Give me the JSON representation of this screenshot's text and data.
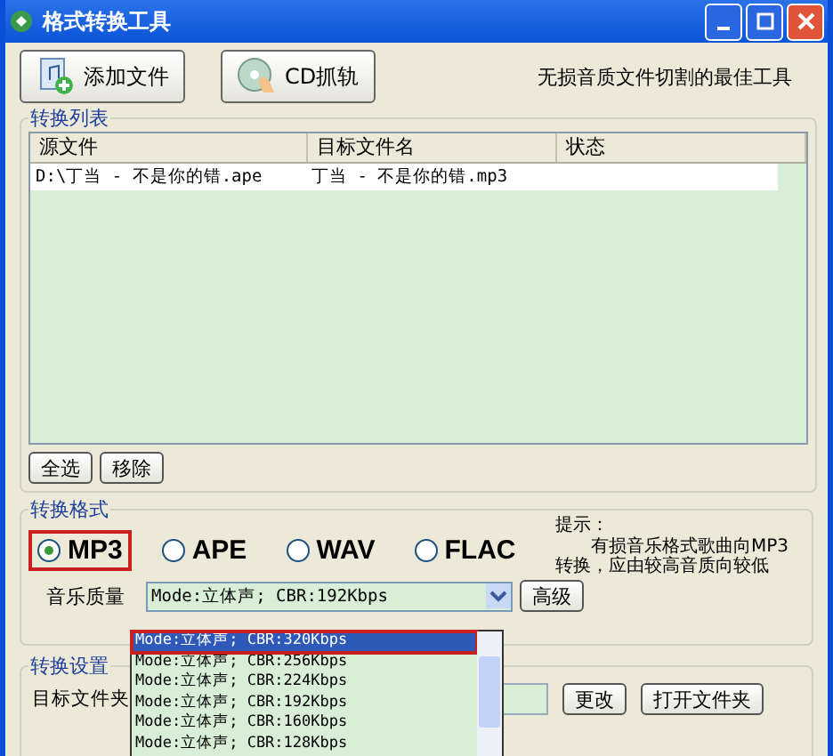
{
  "window": {
    "title": "格式转换工具"
  },
  "toolbar": {
    "buttons": [
      {
        "kind": "add",
        "label": "添加文件"
      },
      {
        "kind": "cd",
        "label": "CD抓轨"
      }
    ],
    "slogan": "无损音质文件切割的最佳工具"
  },
  "list_group": {
    "title": "转换列表",
    "columns": [
      "源文件",
      "目标文件名",
      "状态"
    ],
    "rows": [
      {
        "cells": [
          "D:\\丁当 - 不是你的错.ape",
          "丁当 - 不是你的错.mp3"
        ]
      }
    ],
    "buttons": [
      "全选",
      "移除"
    ]
  },
  "format_group": {
    "title": "转换格式",
    "formats": [
      {
        "label": "MP3",
        "selected": true
      },
      {
        "label": "APE",
        "selected": false
      },
      {
        "label": "WAV",
        "selected": false
      },
      {
        "label": "FLAC",
        "selected": false
      }
    ],
    "quality_label": "音乐质量",
    "quality_value": "Mode:立体声; CBR:192Kbps",
    "advanced_button": "高级",
    "hint_title": "提示：",
    "hint_text": "有损音乐格式歌曲向MP3转换，应由较高音质向较低"
  },
  "dropdown": {
    "options": [
      {
        "label": "Mode:立体声; CBR:320Kbps",
        "selected": true
      },
      {
        "label": "Mode:立体声; CBR:256Kbps",
        "selected": false
      },
      {
        "label": "Mode:立体声; CBR:224Kbps",
        "selected": false
      },
      {
        "label": "Mode:立体声; CBR:192Kbps",
        "selected": false
      },
      {
        "label": "Mode:立体声; CBR:160Kbps",
        "selected": false
      },
      {
        "label": "Mode:立体声; CBR:128Kbps",
        "selected": false
      }
    ]
  },
  "settings_group": {
    "title": "转换设置",
    "target_label": "目标文件夹",
    "buttons": [
      "更改",
      "打开文件夹"
    ]
  }
}
